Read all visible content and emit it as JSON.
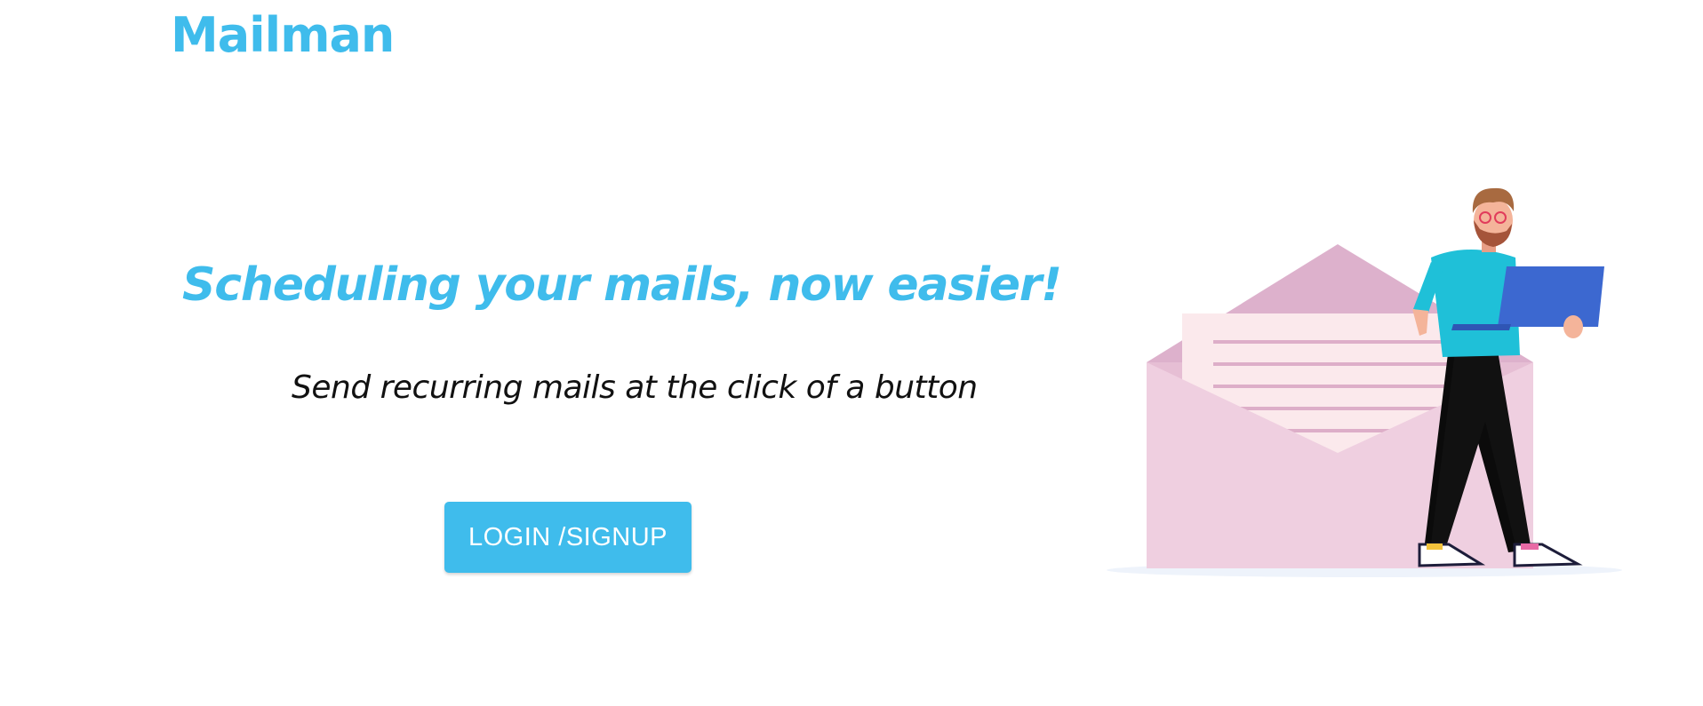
{
  "header": {
    "brand": "Mailman"
  },
  "hero": {
    "headline": "Scheduling your mails, now easier!",
    "subtitle": "Send recurring mails at the click of a button",
    "cta_label": "LOGIN /SIGNUP"
  },
  "illustration": {
    "icon": "man-with-laptop-and-envelope-illustration"
  },
  "colors": {
    "accent": "#3fbcec",
    "envelope": "#efcfe0",
    "envelope_flap": "#ddb1cc",
    "letter": "#fbe9ec",
    "shirt": "#1fc0d8",
    "laptop": "#3c68d0"
  }
}
